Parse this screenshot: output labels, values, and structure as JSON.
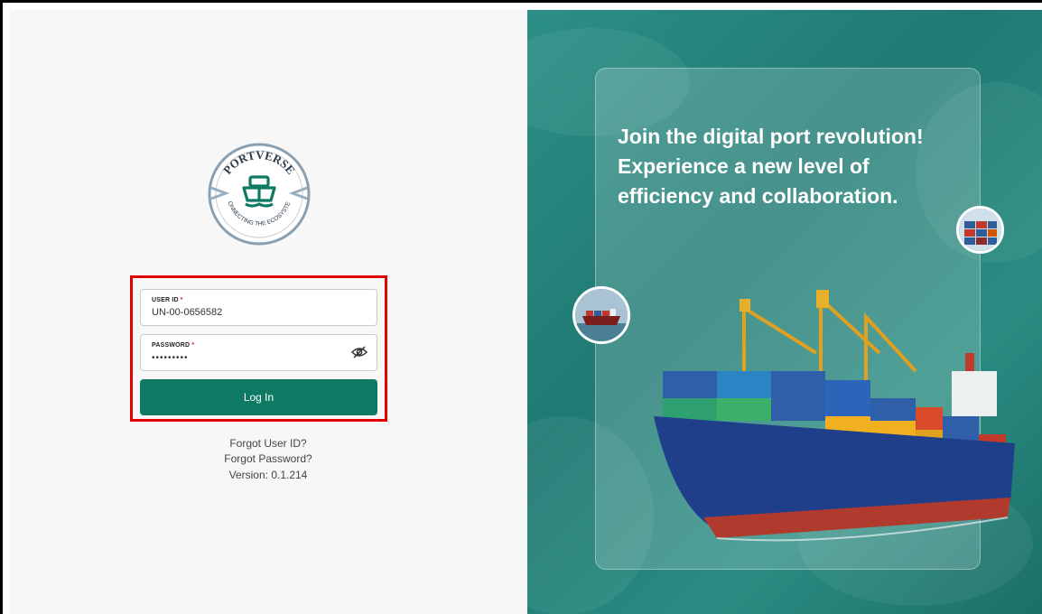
{
  "brand": {
    "name": "PORTVERSE",
    "tagline": "CONNECTING THE ECOSYSTEM"
  },
  "login": {
    "user_id_label": "USER ID",
    "user_id_value": "UN-00-0656582",
    "password_label": "PASSWORD",
    "password_value": "•••••••••",
    "required_mark": "*",
    "submit_label": "Log In"
  },
  "links": {
    "forgot_user": "Forgot User ID?",
    "forgot_password": "Forgot Password?",
    "version": "Version: 0.1.214"
  },
  "promo": {
    "line1": "Join the digital port revolution!",
    "line2": "Experience a new level of",
    "line3": "efficiency and collaboration."
  },
  "colors": {
    "primary": "#0f7a63",
    "highlight": "#e00000",
    "required": "#e02020"
  }
}
